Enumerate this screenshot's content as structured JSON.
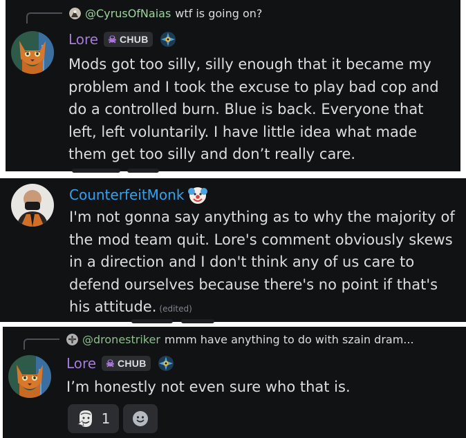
{
  "messages": [
    {
      "reply": {
        "username": "@CyrusOfNaias",
        "text": "wtf is going on?"
      },
      "author": {
        "name": "Lore",
        "tag": "CHUB",
        "tag_icon": "skull-icon",
        "badge": "eye-badge-icon"
      },
      "body": "Mods got too silly, silly enough that it became my problem and I took the excuse to play bad cop and do a controlled burn. Blue is back. Everyone that left, left voluntarily. I have little idea what made them get too silly and don’t really care."
    },
    {
      "author": {
        "name": "CounterfeitMonk",
        "badge": "clown-face-icon"
      },
      "body": "I'm not gonna say anything as to why the majority of the mod team quit. Lore's comment obviously skews in a direction and I don't think any of us care to defend ourselves because there's no point if that's his attitude.",
      "edited": "(edited)"
    },
    {
      "reply": {
        "username": "@dronestriker",
        "text": "mmm have anything to do with szain dram..."
      },
      "author": {
        "name": "Lore",
        "tag": "CHUB",
        "tag_icon": "skull-icon",
        "badge": "eye-badge-icon"
      },
      "body": "I’m honestly not even sure who that is.",
      "reactions": [
        {
          "emoji": "sticker-face-icon",
          "count": "1"
        },
        {
          "emoji": "add-reaction-icon"
        }
      ]
    }
  ],
  "colors": {
    "background": "#111214",
    "lore_name": "#a47bd8",
    "monk_name": "#2fa3f2",
    "reply_name": "#9fd39f",
    "text": "#dbdee1",
    "tag_bg": "#2b2d31"
  }
}
